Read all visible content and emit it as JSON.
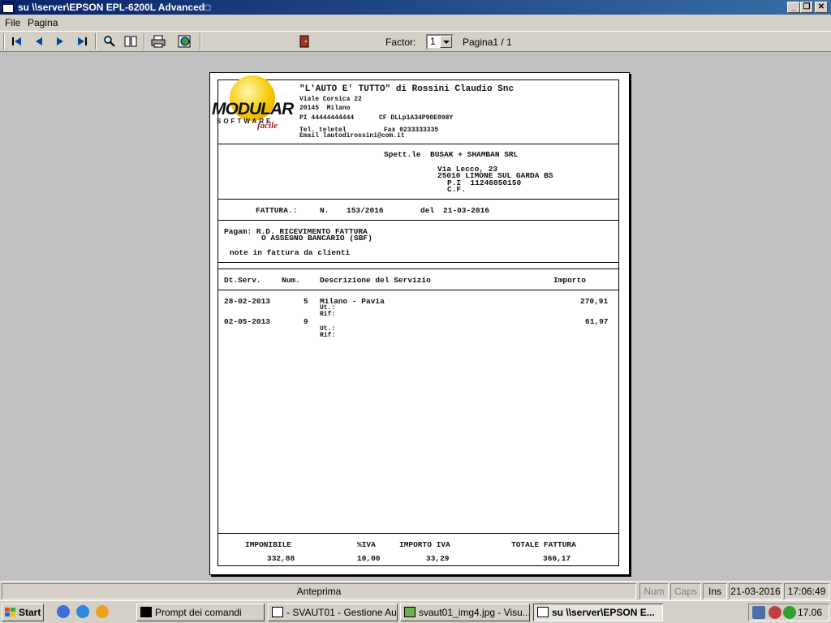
{
  "window": {
    "title": "su \\\\server\\EPSON EPL-6200L Advanced□"
  },
  "menu": [
    "File",
    "Pagina"
  ],
  "toolbar": {
    "factor_label": "Factor:",
    "factor_value": "1",
    "page_label": "Pagina1 / 1"
  },
  "document": {
    "company": "\"L'AUTO E' TUTTO\" di Rossini Claudio Snc",
    "addr1": "Viale Corsica 22",
    "addr2": "20145  Milano",
    "pi": "PI 44444444444",
    "cf": "CF DLLp1A34P90E098Y",
    "tel": "Tel. teletel",
    "fax": "Fax 0233333335",
    "email": "Email lautodirossini@com.it",
    "logo": {
      "word": "MODULAR",
      "sub": "SOFTWARE",
      "tag": "facile"
    },
    "spett": "Spett.le  BUSAK + SHAMBAN SRL",
    "cust_addr": "Via Lecco, 23",
    "cust_city": "25010 LIMONE SUL GARDA BS",
    "cust_pi": "P.I  11246850150",
    "cust_cf": "C.F.",
    "fattura_label": "FATTURA.:",
    "n_label": "N.",
    "number": "153/2016",
    "del_label": "del",
    "date": "21-03-2016",
    "pagam1": "Pagam: R.D. RICEVIMENTO FATTURA",
    "pagam2": "O ASSEGNO BANCARIO (SBF)",
    "note": "note in fattura da clienti",
    "cols": {
      "date": "Dt.Serv.",
      "num": "Num.",
      "desc": "Descrizione del Servizio",
      "amount": "Importo"
    },
    "rows": [
      {
        "date": "28-02-2013",
        "num": "5",
        "desc": "Milano - Pavia",
        "ut": "Ut.:",
        "rif": "Rif:",
        "amount": "270,91"
      },
      {
        "date": "02-05-2013",
        "num": "9",
        "desc": "",
        "ut": "Ut.:",
        "rif": "Rif:",
        "amount": "61,97"
      }
    ],
    "totals": {
      "imponibile_label": "IMPONIBILE",
      "iva_label": "%IVA",
      "importo_iva_label": "IMPORTO IVA",
      "totale_label": "TOTALE FATTURA",
      "imponibile": "332,88",
      "iva": "10,00",
      "importo_iva": "33,29",
      "totale": "366,17"
    }
  },
  "status": {
    "center": "Anteprima",
    "num": "Num",
    "caps": "Caps",
    "ins": "Ins",
    "date": "21-03-2016",
    "time": "17:06:49"
  },
  "taskbar": {
    "start": "Start",
    "tasks": [
      "Prompt dei comandi",
      "- SVAUT01 - Gestione Au...",
      "svaut01_img4.jpg - Visu...",
      "su \\\\server\\EPSON E..."
    ],
    "clock": "17.06"
  }
}
